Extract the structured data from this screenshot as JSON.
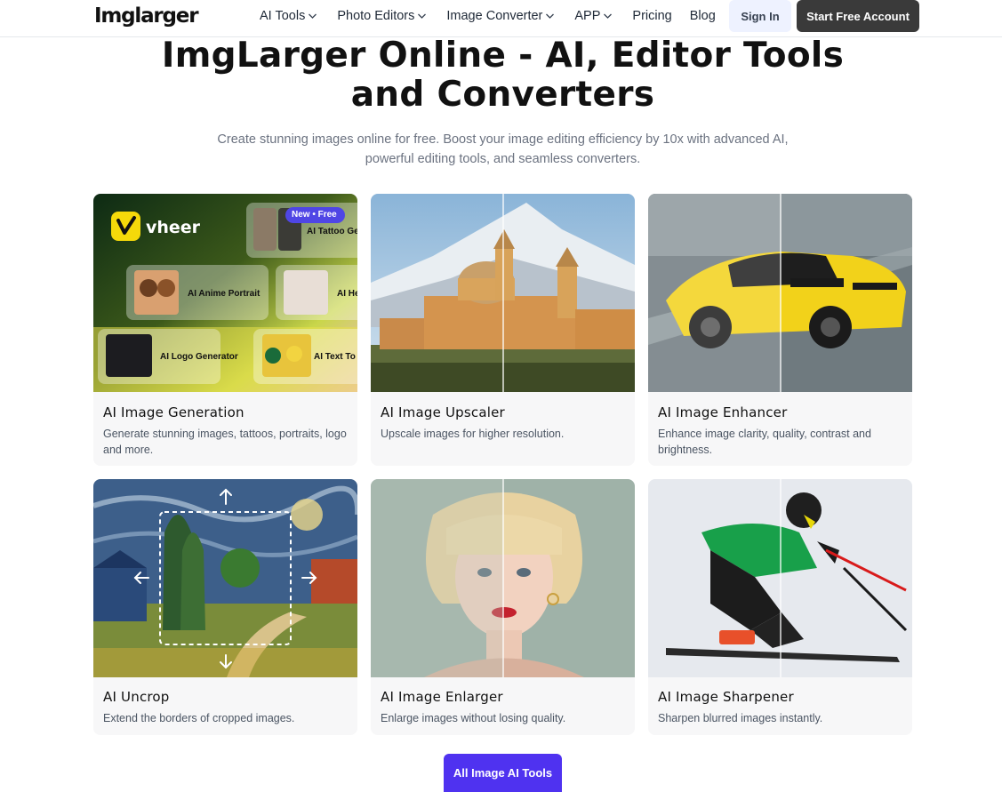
{
  "header": {
    "logo_text": "Imglarger",
    "nav": [
      {
        "label": "AI Tools",
        "has_dropdown": true
      },
      {
        "label": "Photo Editors",
        "has_dropdown": true
      },
      {
        "label": "Image Converter",
        "has_dropdown": true
      },
      {
        "label": "APP",
        "has_dropdown": true
      },
      {
        "label": "Pricing",
        "has_dropdown": false
      },
      {
        "label": "Blog",
        "has_dropdown": false
      }
    ],
    "signin_label": "Sign In",
    "start_label": "Start Free Account"
  },
  "hero": {
    "title_line1": "ImgLarger Online - AI, Editor Tools",
    "title_line2": "and Converters",
    "subtitle_line1": "Create stunning images online for free. Boost your image editing efficiency by 10x with advanced AI,",
    "subtitle_line2": "powerful editing tools, and seamless converters."
  },
  "promo": {
    "brand": "vheer",
    "badge": "New • Free",
    "tiles": [
      "AI Tattoo Ge",
      "AI Anime Portrait",
      "AI He",
      "AI Logo Generator",
      "AI Text To I"
    ]
  },
  "cards": [
    {
      "title": "AI Image Generation",
      "desc": "Generate stunning images, tattoos, portraits, logo and more."
    },
    {
      "title": "AI Image Upscaler",
      "desc": "Upscale images for higher resolution."
    },
    {
      "title": "AI Image Enhancer",
      "desc": "Enhance image clarity, quality, contrast and brightness."
    },
    {
      "title": "AI Uncrop",
      "desc": "Extend the borders of cropped images."
    },
    {
      "title": "AI Image Enlarger",
      "desc": "Enlarge images without losing quality."
    },
    {
      "title": "AI Image Sharpener",
      "desc": "Sharpen blurred images instantly."
    }
  ],
  "cta": {
    "all_tools_label": "All Image AI Tools"
  },
  "colors": {
    "accent": "#4f32f0",
    "dark_button": "#3a3a3a",
    "signin_bg": "#eef2ff",
    "card_bg": "#f7f7f8",
    "muted_text": "#6b7280"
  },
  "icons": [
    "chevron-down-icon",
    "vheer-logo-icon",
    "arrow-up-icon",
    "arrow-down-icon",
    "arrow-left-icon",
    "arrow-right-icon"
  ]
}
